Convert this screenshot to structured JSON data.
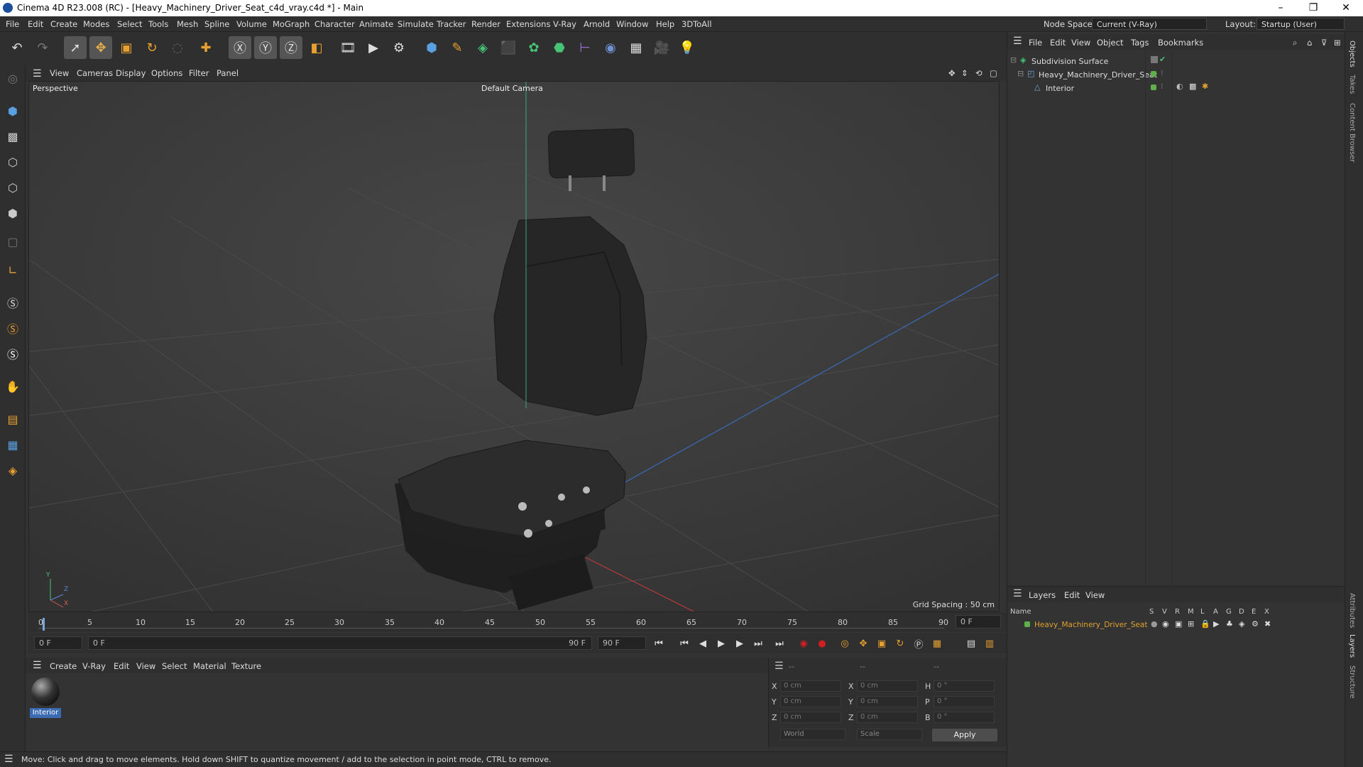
{
  "window": {
    "title": "Cinema 4D R23.008 (RC) - [Heavy_Machinery_Driver_Seat_c4d_vray.c4d *] - Main",
    "minimize": "–",
    "maximize": "❐",
    "close": "✕"
  },
  "menubar": {
    "items": [
      "File",
      "Edit",
      "Create",
      "Modes",
      "Select",
      "Tools",
      "Mesh",
      "Spline",
      "Volume",
      "MoGraph",
      "Character",
      "Animate",
      "Simulate",
      "Tracker",
      "Render",
      "Extensions",
      "V-Ray",
      "Arnold",
      "Window",
      "Help",
      "3DToAll"
    ],
    "node_space_label": "Node Space:",
    "node_space_value": "Current (V-Ray)",
    "layout_label": "Layout:",
    "layout_value": "Startup (User)"
  },
  "viewport_menu": {
    "items": [
      "View",
      "Cameras",
      "Display",
      "Options",
      "Filter",
      "Panel"
    ]
  },
  "viewport": {
    "view_name": "Perspective",
    "camera": "Default Camera",
    "grid_spacing": "Grid Spacing : 50 cm",
    "axis_y": "Y",
    "axis_z": "Z",
    "axis_x": "X"
  },
  "timeline": {
    "ticks": [
      "0",
      "5",
      "10",
      "15",
      "20",
      "25",
      "30",
      "35",
      "40",
      "45",
      "50",
      "55",
      "60",
      "65",
      "70",
      "75",
      "80",
      "85",
      "90"
    ],
    "current_frame_field": "0 F",
    "start_field": "0 F",
    "range_start": "0 F",
    "range_end": "90 F",
    "end_field": "90 F"
  },
  "material_menu": {
    "items": [
      "Create",
      "V-Ray",
      "Edit",
      "View",
      "Select",
      "Material",
      "Texture"
    ]
  },
  "materials": [
    {
      "name": "Interior"
    }
  ],
  "coords": {
    "headers": [
      "--",
      "--",
      "--"
    ],
    "rows": [
      {
        "l1": "X",
        "v1": "0 cm",
        "l2": "X",
        "v2": "0 cm",
        "l3": "H",
        "v3": "0 °"
      },
      {
        "l1": "Y",
        "v1": "0 cm",
        "l2": "Y",
        "v2": "0 cm",
        "l3": "P",
        "v3": "0 °"
      },
      {
        "l1": "Z",
        "v1": "0 cm",
        "l2": "Z",
        "v2": "0 cm",
        "l3": "B",
        "v3": "0 °"
      }
    ],
    "space": "World",
    "mode": "Scale",
    "apply": "Apply"
  },
  "status": {
    "text": "Move: Click and drag to move elements. Hold down SHIFT to quantize movement / add to the selection in point mode, CTRL to remove."
  },
  "object_manager": {
    "menu": [
      "File",
      "Edit",
      "View",
      "Object",
      "Tags",
      "Bookmarks"
    ],
    "objects": [
      {
        "name": "Subdivision Surface",
        "level": 0
      },
      {
        "name": "Heavy_Machinery_Driver_Seat",
        "level": 1
      },
      {
        "name": "Interior",
        "level": 2
      }
    ]
  },
  "layer_manager": {
    "menu": [
      "Layers",
      "Edit",
      "View"
    ],
    "name_header": "Name",
    "col_headers": [
      "S",
      "V",
      "R",
      "M",
      "L",
      "A",
      "G",
      "D",
      "E",
      "X"
    ],
    "layers": [
      {
        "name": "Heavy_Machinery_Driver_Seat",
        "color": "#5fb04a"
      }
    ]
  },
  "right_tabs": [
    "Objects",
    "Takes",
    "Content Browser",
    "Attributes",
    "Layers",
    "Structure"
  ],
  "colors": {
    "accent": "#3b6cb3",
    "layer_text": "#e0a030",
    "green": "#5fb04a",
    "record": "#d02020"
  }
}
